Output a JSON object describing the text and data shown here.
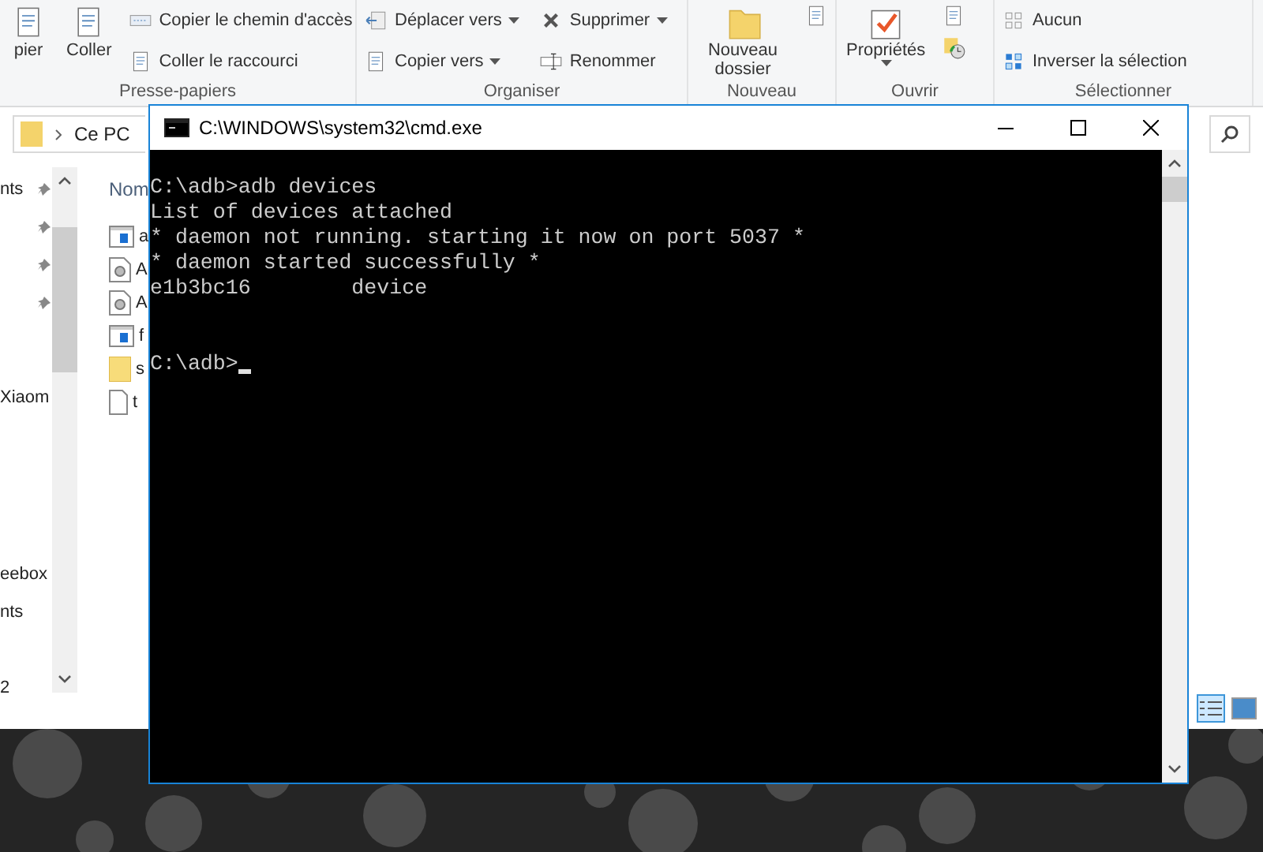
{
  "explorer": {
    "ribbon": {
      "groups": [
        {
          "label": "Presse-papiers",
          "buttons": [
            {
              "label": "pier",
              "kind": "large",
              "dropdown": false
            },
            {
              "label": "Coller",
              "kind": "large",
              "dropdown": false
            },
            {
              "label": "Copier le chemin d'accès",
              "kind": "small",
              "dropdown": false
            },
            {
              "label": "Coller le raccourci",
              "kind": "small",
              "dropdown": false
            }
          ]
        },
        {
          "label": "Organiser",
          "buttons": [
            {
              "label": "Déplacer vers",
              "kind": "small",
              "dropdown": true
            },
            {
              "label": "Copier vers",
              "kind": "small",
              "dropdown": true
            },
            {
              "label": "Supprimer",
              "kind": "small",
              "dropdown": true
            },
            {
              "label": "Renommer",
              "kind": "small",
              "dropdown": false
            }
          ]
        },
        {
          "label": "Nouveau",
          "buttons": [
            {
              "label": "Nouveau dossier",
              "kind": "large",
              "dropdown": false
            }
          ]
        },
        {
          "label": "Ouvrir",
          "buttons": [
            {
              "label": "Propriétés",
              "kind": "large",
              "dropdown": true
            }
          ]
        },
        {
          "label": "Sélectionner",
          "buttons": [
            {
              "label": "Aucun",
              "kind": "small",
              "dropdown": false
            },
            {
              "label": "Inverser la sélection",
              "kind": "small",
              "dropdown": false
            }
          ]
        }
      ]
    },
    "address": {
      "path": "Ce PC"
    },
    "nav_groups": [
      [
        {
          "label": "nts",
          "pinned": true
        },
        {
          "pinned": true
        },
        {
          "pinned": true
        },
        {
          "pinned": true
        }
      ],
      [
        {
          "label": "Xiaom",
          "pinned": false
        }
      ],
      [
        {
          "label": "eebox",
          "pinned": false
        },
        {
          "label": "nts",
          "pinned": false
        }
      ],
      [
        {
          "label": "2",
          "pinned": false
        }
      ]
    ],
    "files": {
      "column": "Nom",
      "items": [
        {
          "name": "a",
          "kind": "app"
        },
        {
          "name": "A",
          "kind": "settings"
        },
        {
          "name": "A",
          "kind": "settings"
        },
        {
          "name": "f",
          "kind": "app"
        },
        {
          "name": "s",
          "kind": "folder"
        },
        {
          "name": "t",
          "kind": "file"
        }
      ]
    }
  },
  "console": {
    "title": "C:\\WINDOWS\\system32\\cmd.exe",
    "lines": [
      "C:\\adb>adb devices",
      "List of devices attached",
      "* daemon not running. starting it now on port 5037 *",
      "* daemon started successfully *",
      "e1b3bc16        device"
    ],
    "prompt": "C:\\adb>"
  }
}
